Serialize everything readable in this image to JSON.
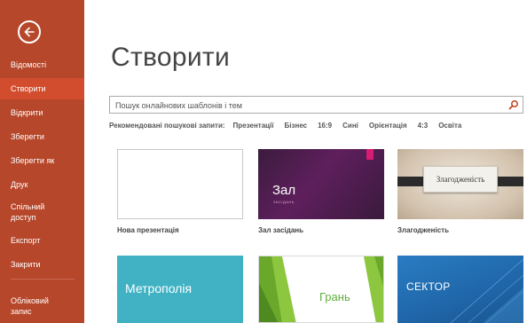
{
  "sidebar": {
    "back_icon": "back-arrow-icon",
    "items": [
      {
        "label": "Відомості"
      },
      {
        "label": "Створити",
        "active": true
      },
      {
        "label": "Відкрити"
      },
      {
        "label": "Зберегти"
      },
      {
        "label": "Зберегти як"
      },
      {
        "label": "Друк"
      },
      {
        "label": "Спільний доступ"
      },
      {
        "label": "Експорт"
      },
      {
        "label": "Закрити"
      },
      {
        "label": "Обліковий запис"
      }
    ]
  },
  "main": {
    "title": "Створити",
    "search": {
      "placeholder": "Пошук онлайнових шаблонів і тем",
      "icon": "search-icon"
    },
    "suggested": {
      "label": "Рекомендовані пошукові запити:",
      "links": [
        "Презентації",
        "Бізнес",
        "16:9",
        "Сині",
        "Орієнтація",
        "4:3",
        "Освіта"
      ]
    },
    "templates": [
      {
        "name": "Нова презентація"
      },
      {
        "name": "Зал засідань",
        "thumb_title": "Зал",
        "thumb_subtitle": "ЗАСІДАНЬ"
      },
      {
        "name": "Злагодженість",
        "thumb_title": "Злагодженість"
      },
      {
        "thumb_title": "Метрополія"
      },
      {
        "thumb_title": "Грань"
      },
      {
        "thumb_title": "СЕКТОР"
      }
    ]
  },
  "colors": {
    "sidebar_bg": "#b7472a",
    "sidebar_active": "#d24d2e",
    "accent_search": "#c43e1c"
  }
}
